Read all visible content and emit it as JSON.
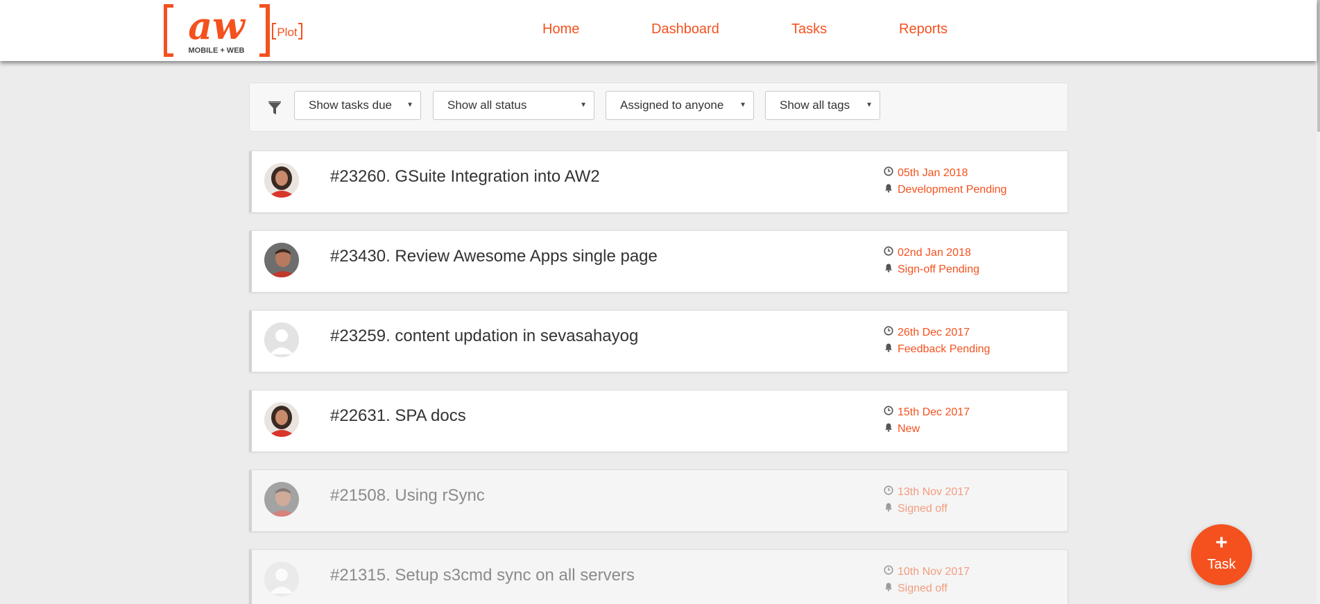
{
  "app": {
    "logo_main": "aw",
    "logo_sub": "MOBILE + WEB",
    "logo_product": "Plot"
  },
  "nav": {
    "items": [
      {
        "label": "Home"
      },
      {
        "label": "Dashboard"
      },
      {
        "label": "Tasks"
      },
      {
        "label": "Reports"
      }
    ]
  },
  "filters": {
    "icon": "filter-icon",
    "selects": [
      {
        "value": "Show tasks due"
      },
      {
        "value": "Show all status"
      },
      {
        "value": "Assigned to anyone"
      },
      {
        "value": "Show all tags"
      }
    ]
  },
  "tasks": [
    {
      "title": "#23260. GSuite Integration into AW2",
      "due": "05th Jan 2018",
      "status": "Development Pending",
      "avatar": "woman-avatar",
      "completed": false
    },
    {
      "title": "#23430. Review Awesome Apps single page",
      "due": "02nd Jan 2018",
      "status": "Sign-off Pending",
      "avatar": "man-avatar",
      "completed": false
    },
    {
      "title": "#23259. content updation in sevasahayog",
      "due": "26th Dec 2017",
      "status": "Feedback Pending",
      "avatar": "default-avatar",
      "completed": false
    },
    {
      "title": "#22631. SPA docs",
      "due": "15th Dec 2017",
      "status": "New",
      "avatar": "woman-avatar",
      "completed": false
    },
    {
      "title": "#21508. Using rSync",
      "due": "13th Nov 2017",
      "status": "Signed off",
      "avatar": "man-avatar",
      "completed": true
    },
    {
      "title": "#21315. Setup s3cmd sync on all servers",
      "due": "10th Nov 2017",
      "status": "Signed off",
      "avatar": "default-avatar",
      "completed": true
    }
  ],
  "fab": {
    "icon": "plus-icon",
    "label": "Task"
  },
  "colors": {
    "accent": "#f4511e",
    "background": "#ececec"
  }
}
